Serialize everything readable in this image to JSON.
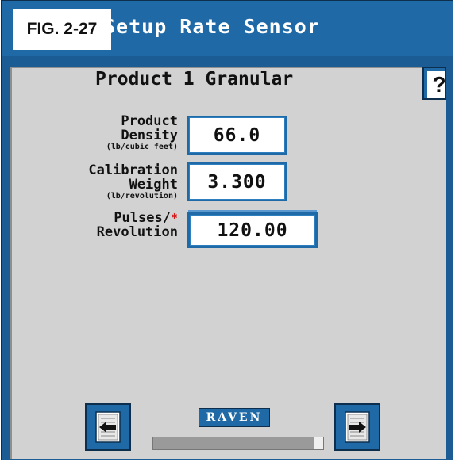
{
  "figure_label": "FIG. 2-27",
  "screen": {
    "title": "Setup Rate Sensor",
    "product_title": "Product 1 Granular",
    "help_label": "?"
  },
  "fields": [
    {
      "label_lines": [
        "Product",
        "Density"
      ],
      "unit": "(lb/cubic feet)",
      "value": "66.0",
      "required": false
    },
    {
      "label_lines": [
        "Calibration",
        "Weight"
      ],
      "unit": "(lb/revolution)",
      "value": "3.300",
      "required": false
    },
    {
      "label_lines": [
        "Pulses/",
        "Revolution"
      ],
      "unit": "",
      "value": "120.00",
      "required": true,
      "required_mark": "*"
    }
  ],
  "footer": {
    "back_icon": "page-back-icon",
    "next_icon": "page-next-icon",
    "logo_text": "RAVEN",
    "progress_fraction": 0.95
  },
  "colors": {
    "titlebar": "#1f6aa6",
    "frame": "#1a5c93",
    "panel": "#d2d2d2",
    "required_mark": "#d21c1c"
  }
}
